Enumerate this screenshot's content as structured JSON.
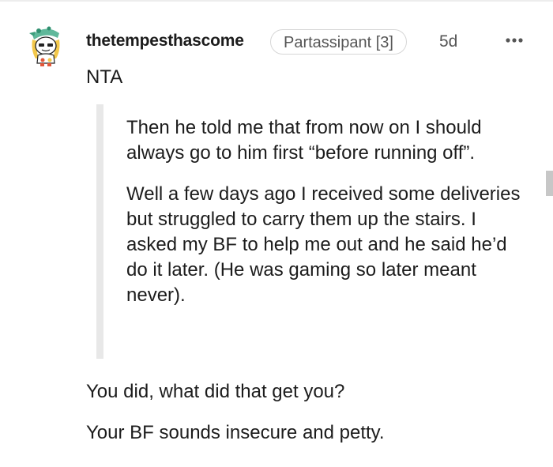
{
  "comment": {
    "author": {
      "username": "thetempesthascome",
      "flair": "Partassipant [3]",
      "avatar_icon": "snoo-avatar-icon"
    },
    "age": "5d",
    "more_icon": "ellipsis-icon",
    "body": {
      "verdict": "NTA",
      "quote": [
        "Then he told me that from now on I should always go to him first “before running off”.",
        "Well a few days ago I received some deliveries but struggled to carry them up the stairs. I asked my BF to help me out and he said he’d do it later. (He was gaming so later meant never)."
      ],
      "replies": [
        "You did, what did that get you?",
        "Your BF sounds insecure and petty."
      ]
    }
  }
}
